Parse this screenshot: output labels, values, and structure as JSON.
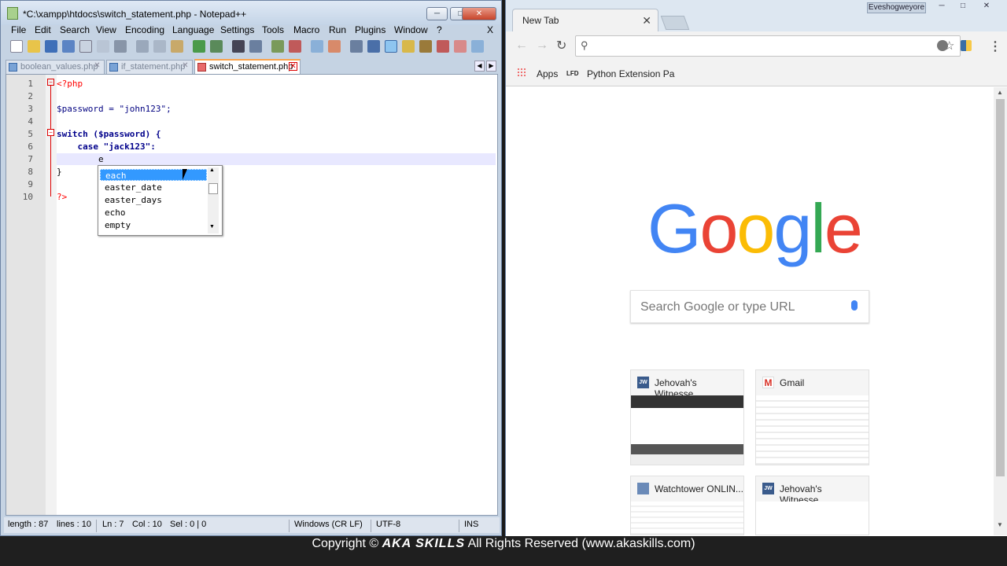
{
  "npp": {
    "title": "*C:\\xampp\\htdocs\\switch_statement.php - Notepad++",
    "menu": [
      "File",
      "Edit",
      "Search",
      "View",
      "Encoding",
      "Language",
      "Settings",
      "Tools",
      "Macro",
      "Run",
      "Plugins",
      "Window",
      "?"
    ],
    "menu_close": "X",
    "tabs": [
      {
        "label": "boolean_values.php"
      },
      {
        "label": "if_statement.php"
      },
      {
        "label": "switch_statement.php"
      }
    ],
    "lines": [
      {
        "n": "1",
        "text": "<?php"
      },
      {
        "n": "2",
        "text": ""
      },
      {
        "n": "3",
        "text": "$password = \"john123\";"
      },
      {
        "n": "4",
        "text": ""
      },
      {
        "n": "5",
        "text": "switch ($password) {"
      },
      {
        "n": "6",
        "text": "    case \"jack123\":"
      },
      {
        "n": "7",
        "text": "        e"
      },
      {
        "n": "8",
        "text": "}"
      },
      {
        "n": "9",
        "text": ""
      },
      {
        "n": "10",
        "text": "?>"
      }
    ],
    "autocomplete": [
      "each",
      "easter_date",
      "easter_days",
      "echo",
      "empty"
    ],
    "status": {
      "length": "length : 87",
      "lines": "lines : 10",
      "ln": "Ln : 7",
      "col": "Col : 10",
      "sel": "Sel : 0 | 0",
      "eol": "Windows (CR LF)",
      "encoding": "UTF-8",
      "mode": "INS"
    }
  },
  "chrome": {
    "tab_title": "New Tab",
    "user": "Eveshogweyore",
    "bookmarks": {
      "apps": "Apps",
      "lfd": "LFD",
      "python": "Python Extension Pa"
    },
    "search_placeholder": "Search Google or type URL",
    "tiles": [
      {
        "title": "Jehovah's Witnesse...",
        "icon": "jw-icon"
      },
      {
        "title": "Gmail",
        "icon": "gmail-icon"
      },
      {
        "title": "Watchtower ONLIN...",
        "icon": "watchtower-icon"
      },
      {
        "title": "Jehovah's Witnesse...",
        "icon": "jw-icon"
      }
    ],
    "jw_fav": "JW",
    "gmail_fav": "M",
    "google_letters": [
      "G",
      "o",
      "o",
      "g",
      "l",
      "e"
    ],
    "google_colors": [
      "#4285f4",
      "#ea4335",
      "#fbbc05",
      "#4285f4",
      "#34a853",
      "#ea4335"
    ]
  },
  "footer": {
    "copyright": "Copyright ©",
    "brand": "AKA SKILLS",
    "rest": "All Rights Reserved (www.akaskills.com)"
  }
}
